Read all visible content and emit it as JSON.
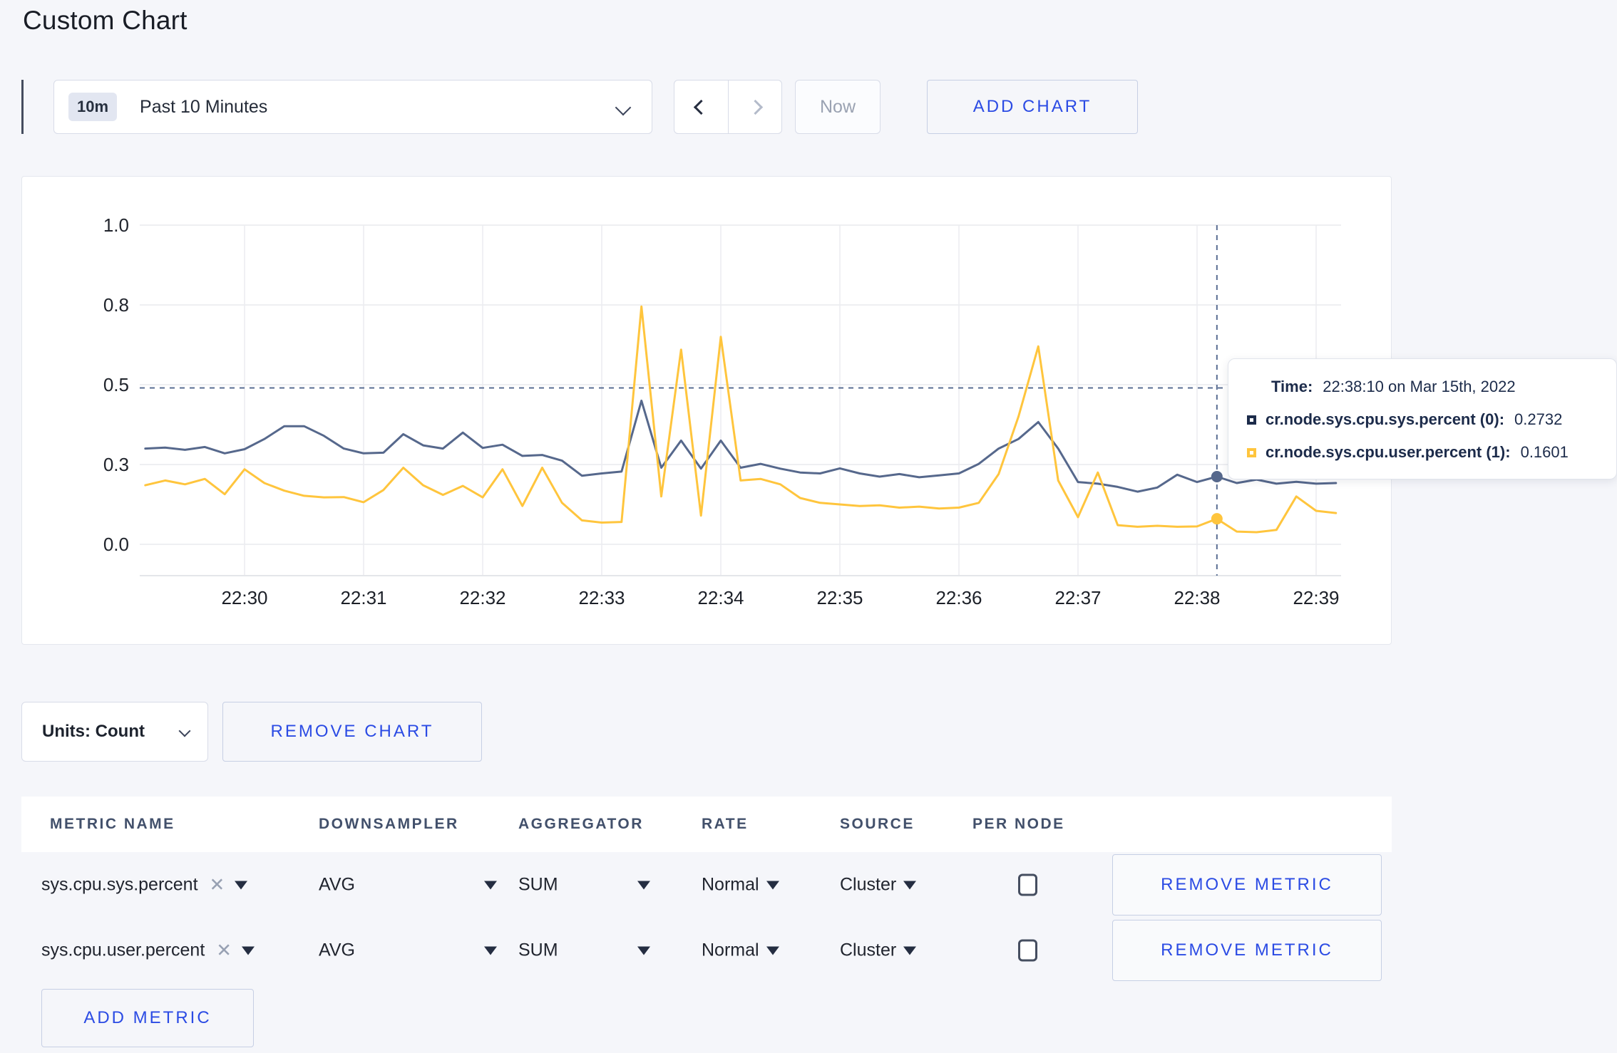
{
  "page": {
    "title": "Custom Chart"
  },
  "toolbar": {
    "range_badge": "10m",
    "range_label": "Past 10 Minutes",
    "now_label": "Now",
    "add_chart_label": "ADD CHART"
  },
  "chart_data": {
    "type": "line",
    "title": "",
    "xlabel": "",
    "ylabel": "",
    "ylim": [
      0,
      1
    ],
    "grid": true,
    "legend_position": "tooltip-only",
    "x_ticks": [
      {
        "t_sec": 0,
        "label": "22:30"
      },
      {
        "t_sec": 60,
        "label": "22:31"
      },
      {
        "t_sec": 120,
        "label": "22:32"
      },
      {
        "t_sec": 180,
        "label": "22:33"
      },
      {
        "t_sec": 240,
        "label": "22:34"
      },
      {
        "t_sec": 300,
        "label": "22:35"
      },
      {
        "t_sec": 360,
        "label": "22:36"
      },
      {
        "t_sec": 420,
        "label": "22:37"
      },
      {
        "t_sec": 480,
        "label": "22:38"
      },
      {
        "t_sec": 540,
        "label": "22:39"
      }
    ],
    "y_ticks": [
      {
        "value": 0,
        "label": "0.0"
      },
      {
        "value": 0.25,
        "label": "0.3"
      },
      {
        "value": 0.5,
        "label": "0.5"
      },
      {
        "value": 0.75,
        "label": "0.8"
      },
      {
        "value": 1,
        "label": "1.0"
      }
    ],
    "t_start_sec": -50,
    "t_step_sec": 10,
    "series": [
      {
        "name": "cr.node.sys.cpu.sys.percent",
        "color": "#56688c",
        "values": [
          0.3,
          0.303,
          0.296,
          0.305,
          0.285,
          0.298,
          0.33,
          0.37,
          0.37,
          0.34,
          0.3,
          0.285,
          0.287,
          0.345,
          0.31,
          0.3,
          0.35,
          0.302,
          0.312,
          0.277,
          0.28,
          0.262,
          0.215,
          0.222,
          0.228,
          0.45,
          0.24,
          0.325,
          0.237,
          0.325,
          0.24,
          0.252,
          0.237,
          0.225,
          0.222,
          0.238,
          0.222,
          0.212,
          0.22,
          0.21,
          0.216,
          0.222,
          0.252,
          0.3,
          0.33,
          0.383,
          0.3,
          0.195,
          0.19,
          0.18,
          0.165,
          0.178,
          0.218,
          0.195,
          0.212,
          0.192,
          0.203,
          0.19,
          0.196,
          0.19,
          0.192
        ]
      },
      {
        "name": "cr.node.sys.cpu.user.percent",
        "color": "#ffc53d",
        "values": [
          0.185,
          0.2,
          0.188,
          0.205,
          0.157,
          0.235,
          0.192,
          0.168,
          0.152,
          0.147,
          0.148,
          0.132,
          0.17,
          0.24,
          0.185,
          0.155,
          0.183,
          0.147,
          0.235,
          0.12,
          0.24,
          0.13,
          0.075,
          0.068,
          0.07,
          0.745,
          0.15,
          0.61,
          0.09,
          0.65,
          0.2,
          0.205,
          0.188,
          0.145,
          0.13,
          0.125,
          0.12,
          0.122,
          0.115,
          0.118,
          0.112,
          0.115,
          0.13,
          0.22,
          0.4,
          0.62,
          0.2,
          0.085,
          0.225,
          0.06,
          0.055,
          0.058,
          0.055,
          0.056,
          0.08,
          0.04,
          0.038,
          0.045,
          0.15,
          0.105,
          0.098
        ]
      }
    ],
    "crosshair": {
      "t_sec": 490,
      "hover_value": 0.49
    }
  },
  "tooltip": {
    "time_label": "Time:",
    "time_value": "22:38:10 on Mar 15th, 2022",
    "rows": [
      {
        "name": "cr.node.sys.cpu.sys.percent (0):",
        "value": "0.2732",
        "color": "#1c2b4a"
      },
      {
        "name": "cr.node.sys.cpu.user.percent (1):",
        "value": "0.1601",
        "color": "#ffc53d"
      }
    ]
  },
  "chart_footer": {
    "units_label": "Units: Count",
    "remove_chart_label": "REMOVE CHART"
  },
  "metrics_table": {
    "headers": [
      "METRIC NAME",
      "DOWNSAMPLER",
      "AGGREGATOR",
      "RATE",
      "SOURCE",
      "PER NODE"
    ],
    "rows": [
      {
        "metric": "sys.cpu.sys.percent",
        "close": "✕",
        "downsampler": "AVG",
        "aggregator": "SUM",
        "rate": "Normal",
        "source": "Cluster",
        "per_node_checked": false,
        "remove_label": "REMOVE METRIC"
      },
      {
        "metric": "sys.cpu.user.percent",
        "close": "✕",
        "downsampler": "AVG",
        "aggregator": "SUM",
        "rate": "Normal",
        "source": "Cluster",
        "per_node_checked": false,
        "remove_label": "REMOVE METRIC"
      }
    ],
    "add_metric_label": "ADD METRIC"
  }
}
